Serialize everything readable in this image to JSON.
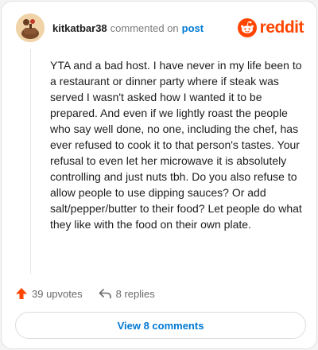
{
  "header": {
    "username": "kitkatbar38",
    "commented_on": "commented on",
    "post_link": "post",
    "brand": "reddit",
    "brand_color": "#ff4500"
  },
  "comment": {
    "body": "YTA and a bad host. I have never in my life been to a restaurant or dinner party where if steak was served I wasn't asked how I wanted it to be prepared. And even if we lightly roast the people who say well done, no one, including the chef, has ever refused to cook it to that person's tastes. Your refusal to even let her microwave it is absolutely controlling and just nuts tbh. Do you also refuse to allow people to use dipping sauces? Or add salt/pepper/butter to their food? Let people do what they like with the food on their own plate."
  },
  "actions": {
    "upvotes": "39 upvotes",
    "replies": "8 replies",
    "upvote_icon": "upvote-arrow-icon",
    "reply_icon": "reply-arrow-icon",
    "upvote_color": "#ff4500"
  },
  "footer": {
    "view_comments": "View 8 comments"
  },
  "colors": {
    "link": "#0079d3",
    "text": "#1c1c1c",
    "muted": "#7c7c7c"
  }
}
